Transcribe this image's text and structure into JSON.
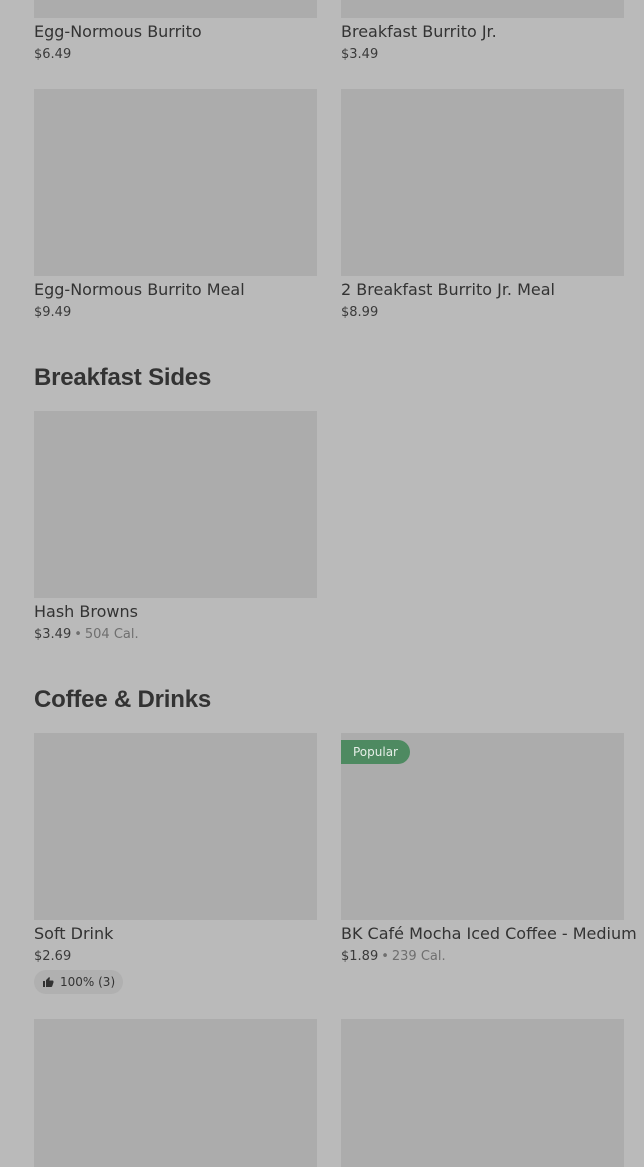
{
  "sections": {
    "breakfast_sides": {
      "title": "Breakfast Sides"
    },
    "coffee_drinks": {
      "title": "Coffee & Drinks"
    }
  },
  "items": {
    "egg_normous_burrito": {
      "name": "Egg-Normous Burrito",
      "price": "$6.49"
    },
    "breakfast_burrito_jr": {
      "name": "Breakfast Burrito Jr.",
      "price": "$3.49"
    },
    "egg_normous_burrito_meal": {
      "name": "Egg-Normous Burrito Meal",
      "price": "$9.49"
    },
    "two_breakfast_burrito_jr_meal": {
      "name": "2 Breakfast Burrito Jr. Meal",
      "price": "$8.99"
    },
    "hash_browns": {
      "name": "Hash Browns",
      "price": "$3.49",
      "separator": "•",
      "calories": "504 Cal."
    },
    "soft_drink": {
      "name": "Soft Drink",
      "price": "$2.69",
      "rating": "100% (3)"
    },
    "bk_cafe_mocha": {
      "name": "BK Café Mocha Iced Coffee - Medium",
      "price": "$1.89",
      "separator": "•",
      "calories": "239 Cal.",
      "badge": "Popular"
    }
  },
  "colors": {
    "background": "#bababa",
    "image_placeholder": "#acacac",
    "badge_green": "#4e8a61",
    "text": "#333333"
  },
  "icons": {
    "rating": "thumbs-up-icon"
  }
}
